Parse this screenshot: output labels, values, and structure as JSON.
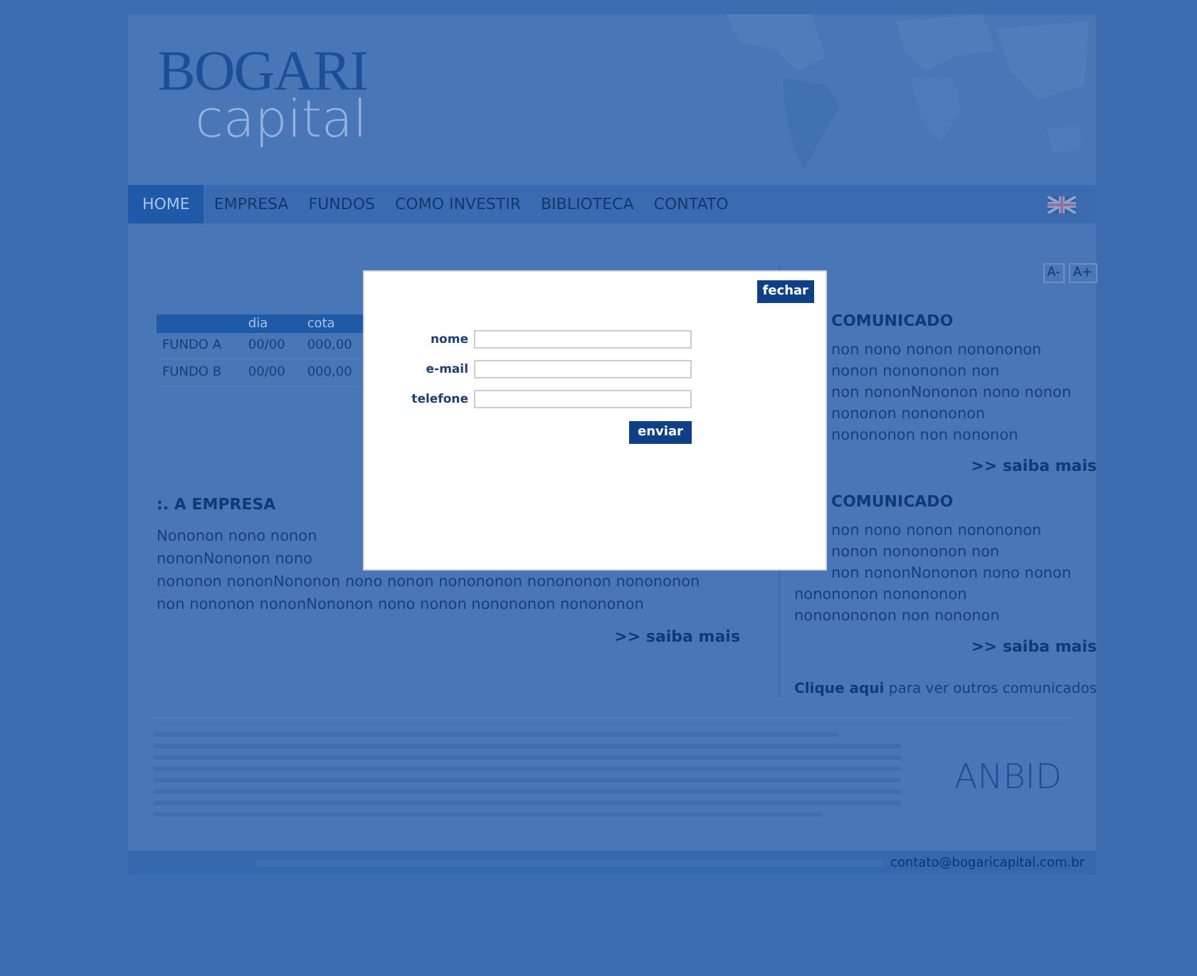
{
  "logo": {
    "name": "BOGARI",
    "subtitle": "capital"
  },
  "nav": {
    "items": [
      {
        "label": "HOME",
        "selected": true
      },
      {
        "label": "EMPRESA",
        "selected": false
      },
      {
        "label": "FUNDOS",
        "selected": false
      },
      {
        "label": "COMO INVESTIR",
        "selected": false
      },
      {
        "label": "BIBLIOTECA",
        "selected": false
      },
      {
        "label": "CONTATO",
        "selected": false
      }
    ]
  },
  "font_size_buttons": [
    "A-",
    "A+"
  ],
  "fund_table": {
    "columns": [
      "dia",
      "cota"
    ],
    "rows": [
      {
        "name": "FUNDO A",
        "date": "00/00",
        "quota": "000,00"
      },
      {
        "name": "FUNDO B",
        "date": "00/00",
        "quota": "000,00"
      }
    ]
  },
  "company": {
    "heading": ":. A EMPRESA",
    "lines": [
      "Nononon nono nonon",
      "nononNononon nono",
      "nononon nononNononon nono nonon nonononon nonononon nonononon",
      "non nononon nononNononon nono nonon nonononon nonononon"
    ],
    "more": ">> saiba mais"
  },
  "news": [
    {
      "heading": "COMUNICADO",
      "lines": [
        "non nono nonon nonononon",
        "nonon nonononon non",
        "non nononNononon nono nonon",
        "nononon nonononon",
        "nonononon non nononon"
      ],
      "more": ">> saiba mais"
    },
    {
      "heading": "COMUNICADO",
      "lines": [
        "non nono nonon nonononon",
        "nonon nonononon non",
        "non nononNononon nono nonon",
        "nonononon nonononon",
        "nononononon non nononon"
      ],
      "more": ">> saiba mais"
    }
  ],
  "news_link": {
    "link": "Clique aqui",
    "text": "para ver outros comunicados"
  },
  "footer": {
    "partner_logo": "ANBID",
    "email": "contato@bogaricapital.com.br"
  },
  "dialog": {
    "close": "fechar",
    "fields": [
      {
        "label": "nome"
      },
      {
        "label": "e-mail"
      },
      {
        "label": "telefone"
      }
    ],
    "submit": "enviar"
  }
}
